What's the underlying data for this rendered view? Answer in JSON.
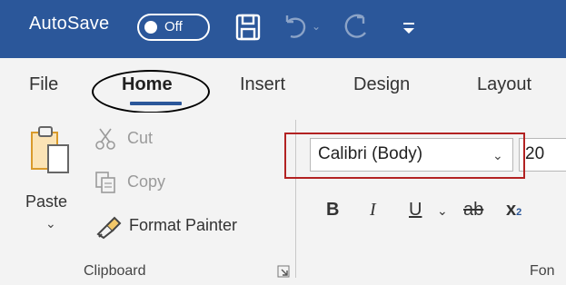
{
  "titlebar": {
    "autosave_label": "AutoSave",
    "toggle_state": "Off",
    "save_icon": "save-icon",
    "undo_icon": "undo-icon",
    "redo_icon": "redo-icon",
    "customize_icon": "customize-qat-icon",
    "background": "#2b579a"
  },
  "tabs": [
    {
      "label": "File"
    },
    {
      "label": "Home",
      "active": true
    },
    {
      "label": "Insert"
    },
    {
      "label": "Design"
    },
    {
      "label": "Layout"
    }
  ],
  "clipboard": {
    "paste_label": "Paste",
    "cut_label": "Cut",
    "copy_label": "Copy",
    "format_painter_label": "Format Painter",
    "group_label": "Clipboard"
  },
  "font": {
    "font_name": "Calibri (Body)",
    "font_size": "20",
    "bold": "B",
    "italic": "I",
    "underline": "U",
    "strikethrough": "ab",
    "subscript": "x",
    "subscript_small": "2",
    "group_label": "Fon"
  },
  "colors": {
    "accent": "#2b579a",
    "highlight_red": "#b22222"
  }
}
